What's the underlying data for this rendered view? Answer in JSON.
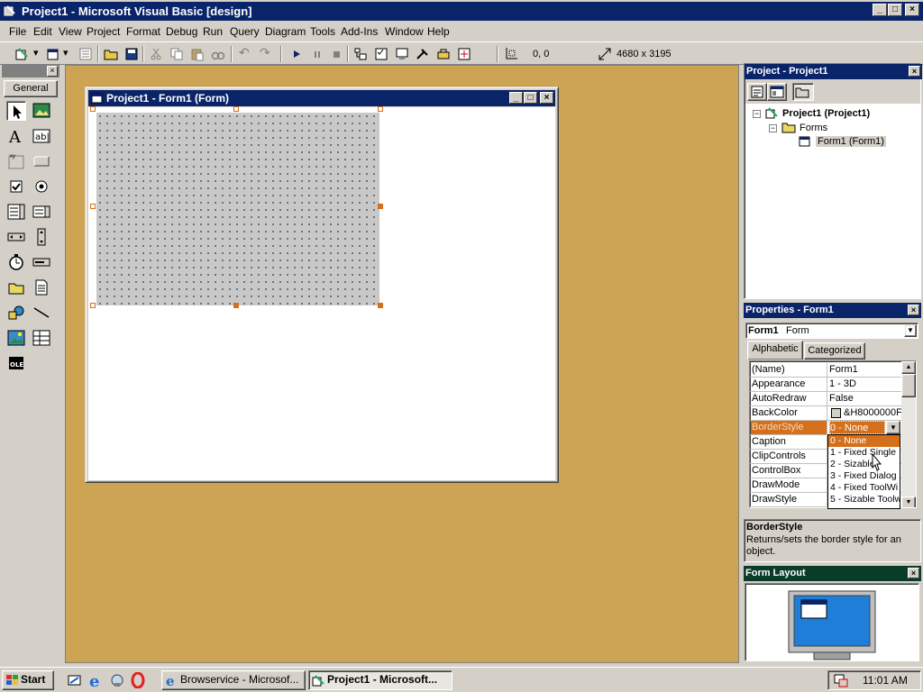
{
  "app": {
    "title": "Project1 - Microsoft Visual Basic [design]"
  },
  "menu": [
    "File",
    "Edit",
    "View",
    "Project",
    "Format",
    "Debug",
    "Run",
    "Query",
    "Diagram",
    "Tools",
    "Add-Ins",
    "Window",
    "Help"
  ],
  "toolbar": {
    "position": "0, 0",
    "size": "4680 x 3195"
  },
  "toolbox": {
    "tab_label": "General"
  },
  "form_window": {
    "title": "Project1 - Form1 (Form)"
  },
  "project_explorer": {
    "title": "Project - Project1",
    "tree": [
      "Project1 (Project1)",
      "Forms",
      "Form1 (Form1)"
    ]
  },
  "properties": {
    "title": "Properties - Form1",
    "object_name": "Form1",
    "object_type": "Form",
    "tabs": [
      "Alphabetic",
      "Categorized"
    ],
    "rows": [
      {
        "name": "(Name)",
        "value": "Form1"
      },
      {
        "name": "Appearance",
        "value": "1 - 3D"
      },
      {
        "name": "AutoRedraw",
        "value": "False"
      },
      {
        "name": "BackColor",
        "value": "&H8000000F"
      },
      {
        "name": "BorderStyle",
        "value": "0 - None"
      },
      {
        "name": "Caption",
        "value": ""
      },
      {
        "name": "ClipControls",
        "value": ""
      },
      {
        "name": "ControlBox",
        "value": ""
      },
      {
        "name": "DrawMode",
        "value": ""
      },
      {
        "name": "DrawStyle",
        "value": ""
      }
    ],
    "dropdown_options": [
      "0 - None",
      "1 - Fixed Single",
      "2 - Sizable",
      "3 - Fixed Dialog",
      "4 - Fixed ToolWi",
      "5 - Sizable Toolw"
    ],
    "description_title": "BorderStyle",
    "description_text": "Returns/sets the border style for an object."
  },
  "form_layout": {
    "title": "Form Layout"
  },
  "taskbar": {
    "start": "Start",
    "items": [
      "Browservice - Microsof...",
      "Project1 - Microsoft..."
    ],
    "clock": "11:01 AM"
  },
  "colors": {
    "titlebar": "#0a246a",
    "workspace": "#cda354",
    "selection": "#d56f1a"
  }
}
